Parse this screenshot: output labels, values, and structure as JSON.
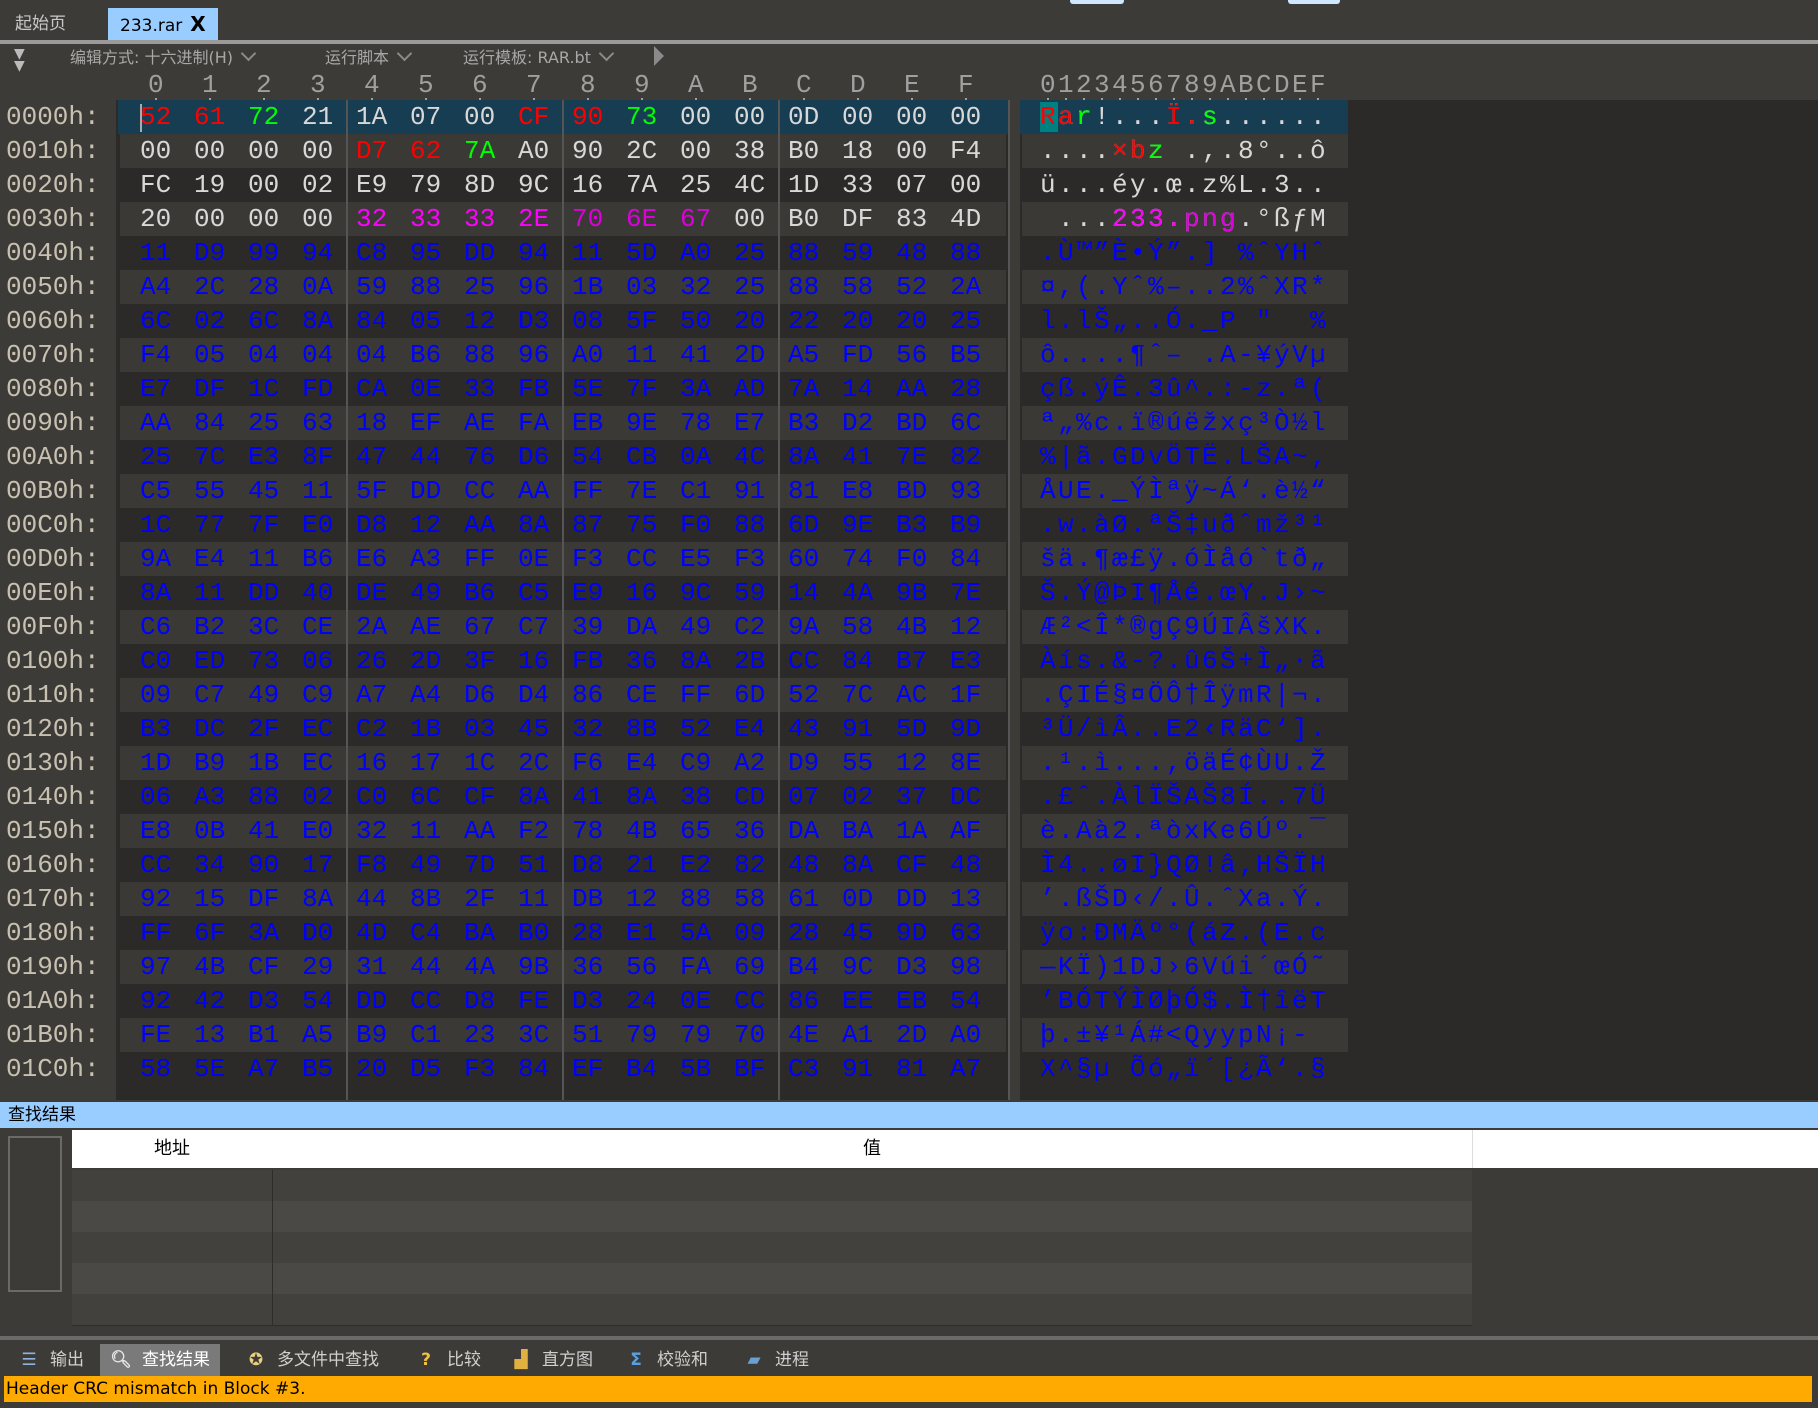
{
  "tabs": [
    {
      "label": "起始页",
      "active": false
    },
    {
      "label": "233.rar",
      "active": true
    }
  ],
  "tab_close": "X",
  "toolbar": {
    "edit_mode": "编辑方式: 十六进制(H)",
    "run_script": "运行脚本",
    "run_template": "运行模板: RAR.bt"
  },
  "hex_columns": [
    "0",
    "1",
    "2",
    "3",
    "4",
    "5",
    "6",
    "7",
    "8",
    "9",
    "A",
    "B",
    "C",
    "D",
    "E",
    "F"
  ],
  "ascii_header": "0123456789ABCDEF",
  "colors": {
    "normal": "#d8d8d8",
    "blue": "#0000ff",
    "red": "#ff0000",
    "green": "#00ff00",
    "magenta": "#ff00ff",
    "purple": "#dd00dd",
    "selected_row": "#173d52",
    "cursor_char": "#008080",
    "find_header": "#99ccff",
    "status_bg": "#ffaa00"
  },
  "rows": [
    {
      "addr": "0000h:",
      "hex": [
        "52",
        "61",
        "72",
        "21",
        "1A",
        "07",
        "00",
        "CF",
        "90",
        "73",
        "00",
        "00",
        "0D",
        "00",
        "00",
        "00"
      ],
      "ascii": "Rar!...Ï.s......",
      "color": "normal",
      "marks": {
        "0": "red",
        "1": "red",
        "2": "green",
        "7": "red",
        "8": "red",
        "9": "green"
      },
      "selected": true
    },
    {
      "addr": "0010h:",
      "hex": [
        "00",
        "00",
        "00",
        "00",
        "D7",
        "62",
        "7A",
        "A0",
        "90",
        "2C",
        "00",
        "38",
        "B0",
        "18",
        "00",
        "F4"
      ],
      "ascii": "....×bz .,.8°..ô",
      "color": "normal",
      "marks": {
        "4": "red",
        "5": "red",
        "6": "green"
      }
    },
    {
      "addr": "0020h:",
      "hex": [
        "FC",
        "19",
        "00",
        "02",
        "E9",
        "79",
        "8D",
        "9C",
        "16",
        "7A",
        "25",
        "4C",
        "1D",
        "33",
        "07",
        "00"
      ],
      "ascii": "ü...éy.œ.z%L.3..",
      "color": "normal",
      "marks": {}
    },
    {
      "addr": "0030h:",
      "hex": [
        "20",
        "00",
        "00",
        "00",
        "32",
        "33",
        "33",
        "2E",
        "70",
        "6E",
        "67",
        "00",
        "B0",
        "DF",
        "83",
        "4D"
      ],
      "ascii": " ...233.png.°ßƒM",
      "color": "normal",
      "marks": {
        "4": "magenta",
        "5": "magenta",
        "6": "magenta",
        "7": "magenta",
        "8": "purple",
        "9": "purple",
        "10": "purple"
      }
    },
    {
      "addr": "0040h:",
      "hex": [
        "11",
        "D9",
        "99",
        "94",
        "C8",
        "95",
        "DD",
        "94",
        "11",
        "5D",
        "A0",
        "25",
        "88",
        "59",
        "48",
        "88"
      ],
      "ascii": ".Ù™”È•Ý”.] %ˆYHˆ",
      "color": "blue",
      "marks": {}
    },
    {
      "addr": "0050h:",
      "hex": [
        "A4",
        "2C",
        "28",
        "0A",
        "59",
        "88",
        "25",
        "96",
        "1B",
        "03",
        "32",
        "25",
        "88",
        "58",
        "52",
        "2A"
      ],
      "ascii": "¤,(.Yˆ%–..2%ˆXR*",
      "color": "blue",
      "marks": {}
    },
    {
      "addr": "0060h:",
      "hex": [
        "6C",
        "02",
        "6C",
        "8A",
        "84",
        "05",
        "12",
        "D3",
        "08",
        "5F",
        "50",
        "20",
        "22",
        "20",
        "20",
        "25"
      ],
      "ascii": "l.lŠ„..Ó._P \"  %",
      "color": "blue",
      "marks": {}
    },
    {
      "addr": "0070h:",
      "hex": [
        "F4",
        "05",
        "04",
        "04",
        "04",
        "B6",
        "88",
        "96",
        "A0",
        "11",
        "41",
        "2D",
        "A5",
        "FD",
        "56",
        "B5"
      ],
      "ascii": "ô....¶ˆ– .A-¥ýVµ",
      "color": "blue",
      "marks": {}
    },
    {
      "addr": "0080h:",
      "hex": [
        "E7",
        "DF",
        "1C",
        "FD",
        "CA",
        "0E",
        "33",
        "FB",
        "5E",
        "7F",
        "3A",
        "AD",
        "7A",
        "14",
        "AA",
        "28"
      ],
      "ascii": "çß.ýÊ.3û^.:-z.ª(",
      "color": "blue",
      "marks": {}
    },
    {
      "addr": "0090h:",
      "hex": [
        "AA",
        "84",
        "25",
        "63",
        "18",
        "EF",
        "AE",
        "FA",
        "EB",
        "9E",
        "78",
        "E7",
        "B3",
        "D2",
        "BD",
        "6C"
      ],
      "ascii": "ª„%c.ï®úëžxç³Ò½l",
      "color": "blue",
      "marks": {}
    },
    {
      "addr": "00A0h:",
      "hex": [
        "25",
        "7C",
        "E3",
        "8F",
        "47",
        "44",
        "76",
        "D6",
        "54",
        "CB",
        "0A",
        "4C",
        "8A",
        "41",
        "7E",
        "82"
      ],
      "ascii": "%|ã.GDvÖTË.LŠA~‚",
      "color": "blue",
      "marks": {}
    },
    {
      "addr": "00B0h:",
      "hex": [
        "C5",
        "55",
        "45",
        "11",
        "5F",
        "DD",
        "CC",
        "AA",
        "FF",
        "7E",
        "C1",
        "91",
        "81",
        "E8",
        "BD",
        "93"
      ],
      "ascii": "ÅUE._ÝÌªÿ~Á‘.è½“",
      "color": "blue",
      "marks": {}
    },
    {
      "addr": "00C0h:",
      "hex": [
        "1C",
        "77",
        "7F",
        "E0",
        "D8",
        "12",
        "AA",
        "8A",
        "87",
        "75",
        "F0",
        "88",
        "6D",
        "9E",
        "B3",
        "B9"
      ],
      "ascii": ".w.àØ.ªŠ‡uðˆmž³¹",
      "color": "blue",
      "marks": {}
    },
    {
      "addr": "00D0h:",
      "hex": [
        "9A",
        "E4",
        "11",
        "B6",
        "E6",
        "A3",
        "FF",
        "0E",
        "F3",
        "CC",
        "E5",
        "F3",
        "60",
        "74",
        "F0",
        "84"
      ],
      "ascii": "šä.¶æ£ÿ.óÌåó`tð„",
      "color": "blue",
      "marks": {}
    },
    {
      "addr": "00E0h:",
      "hex": [
        "8A",
        "11",
        "DD",
        "40",
        "DE",
        "49",
        "B6",
        "C5",
        "E9",
        "16",
        "9C",
        "59",
        "14",
        "4A",
        "9B",
        "7E"
      ],
      "ascii": "Š.Ý@ÞI¶Åé.œY.J›~",
      "color": "blue",
      "marks": {}
    },
    {
      "addr": "00F0h:",
      "hex": [
        "C6",
        "B2",
        "3C",
        "CE",
        "2A",
        "AE",
        "67",
        "C7",
        "39",
        "DA",
        "49",
        "C2",
        "9A",
        "58",
        "4B",
        "12"
      ],
      "ascii": "Æ²<Î*®gÇ9ÚIÂšXK.",
      "color": "blue",
      "marks": {}
    },
    {
      "addr": "0100h:",
      "hex": [
        "C0",
        "ED",
        "73",
        "06",
        "26",
        "2D",
        "3F",
        "16",
        "FB",
        "36",
        "8A",
        "2B",
        "CC",
        "84",
        "B7",
        "E3"
      ],
      "ascii": "Àís.&-?.û6Š+Ì„·ã",
      "color": "blue",
      "marks": {}
    },
    {
      "addr": "0110h:",
      "hex": [
        "09",
        "C7",
        "49",
        "C9",
        "A7",
        "A4",
        "D6",
        "D4",
        "86",
        "CE",
        "FF",
        "6D",
        "52",
        "7C",
        "AC",
        "1F"
      ],
      "ascii": ".ÇIÉ§¤ÖÔ†ÎÿmR|¬.",
      "color": "blue",
      "marks": {}
    },
    {
      "addr": "0120h:",
      "hex": [
        "B3",
        "DC",
        "2F",
        "EC",
        "C2",
        "1B",
        "03",
        "45",
        "32",
        "8B",
        "52",
        "E4",
        "43",
        "91",
        "5D",
        "9D"
      ],
      "ascii": "³Ü/ìÂ..E2‹RäC‘].",
      "color": "blue",
      "marks": {}
    },
    {
      "addr": "0130h:",
      "hex": [
        "1D",
        "B9",
        "1B",
        "EC",
        "16",
        "17",
        "1C",
        "2C",
        "F6",
        "E4",
        "C9",
        "A2",
        "D9",
        "55",
        "12",
        "8E"
      ],
      "ascii": ".¹.ì...,öäÉ¢ÙU.Ž",
      "color": "blue",
      "marks": {}
    },
    {
      "addr": "0140h:",
      "hex": [
        "06",
        "A3",
        "88",
        "02",
        "C0",
        "6C",
        "CF",
        "8A",
        "41",
        "8A",
        "38",
        "CD",
        "07",
        "02",
        "37",
        "DC"
      ],
      "ascii": ".£ˆ.ÀlÏŠAŠ8Í..7Ü",
      "color": "blue",
      "marks": {}
    },
    {
      "addr": "0150h:",
      "hex": [
        "E8",
        "0B",
        "41",
        "E0",
        "32",
        "11",
        "AA",
        "F2",
        "78",
        "4B",
        "65",
        "36",
        "DA",
        "BA",
        "1A",
        "AF"
      ],
      "ascii": "è.Aà2.ªòxKe6Úº.¯",
      "color": "blue",
      "marks": {}
    },
    {
      "addr": "0160h:",
      "hex": [
        "CC",
        "34",
        "90",
        "17",
        "F8",
        "49",
        "7D",
        "51",
        "D8",
        "21",
        "E2",
        "82",
        "48",
        "8A",
        "CF",
        "48"
      ],
      "ascii": "Ì4..øI}QØ!â‚HŠÏH",
      "color": "blue",
      "marks": {}
    },
    {
      "addr": "0170h:",
      "hex": [
        "92",
        "15",
        "DF",
        "8A",
        "44",
        "8B",
        "2F",
        "11",
        "DB",
        "12",
        "88",
        "58",
        "61",
        "0D",
        "DD",
        "13"
      ],
      "ascii": "’.ßŠD‹/.Û.ˆXa.Ý.",
      "color": "blue",
      "marks": {}
    },
    {
      "addr": "0180h:",
      "hex": [
        "FF",
        "6F",
        "3A",
        "D0",
        "4D",
        "C4",
        "BA",
        "B0",
        "28",
        "E1",
        "5A",
        "09",
        "28",
        "45",
        "9D",
        "63"
      ],
      "ascii": "ÿo:ÐMÄº°(áZ.(E.c",
      "color": "blue",
      "marks": {}
    },
    {
      "addr": "0190h:",
      "hex": [
        "97",
        "4B",
        "CF",
        "29",
        "31",
        "44",
        "4A",
        "9B",
        "36",
        "56",
        "FA",
        "69",
        "B4",
        "9C",
        "D3",
        "98"
      ],
      "ascii": "—KÏ)1DJ›6Vúi´œÓ˜",
      "color": "blue",
      "marks": {}
    },
    {
      "addr": "01A0h:",
      "hex": [
        "92",
        "42",
        "D3",
        "54",
        "DD",
        "CC",
        "D8",
        "FE",
        "D3",
        "24",
        "0E",
        "CC",
        "86",
        "EE",
        "EB",
        "54"
      ],
      "ascii": "’BÓTÝÌØþÓ$.Ì†îëT",
      "color": "blue",
      "marks": {}
    },
    {
      "addr": "01B0h:",
      "hex": [
        "FE",
        "13",
        "B1",
        "A5",
        "B9",
        "C1",
        "23",
        "3C",
        "51",
        "79",
        "79",
        "70",
        "4E",
        "A1",
        "2D",
        "A0"
      ],
      "ascii": "þ.±¥¹Á#<QyypN¡- ",
      "color": "blue",
      "marks": {}
    },
    {
      "addr": "01C0h:",
      "hex": [
        "58",
        "5E",
        "A7",
        "B5",
        "20",
        "D5",
        "F3",
        "84",
        "EF",
        "B4",
        "5B",
        "BF",
        "C3",
        "91",
        "81",
        "A7"
      ],
      "ascii": "X^§µ Õó„ï´[¿Ã‘.§",
      "color": "blue",
      "marks": {}
    }
  ],
  "find_results": {
    "title": "查找结果",
    "columns": [
      "地址",
      "值"
    ]
  },
  "bottom_tabs": [
    {
      "label": "输出",
      "icon": "output-icon",
      "active": false
    },
    {
      "label": "查找结果",
      "icon": "magnifier-icon",
      "active": true
    },
    {
      "label": "多文件中查找",
      "icon": "multi-file-find-icon",
      "active": false
    },
    {
      "label": "比较",
      "icon": "question-compare-icon",
      "active": false
    },
    {
      "label": "直方图",
      "icon": "histogram-icon",
      "active": false
    },
    {
      "label": "校验和",
      "icon": "sigma-checksum-icon",
      "active": false
    },
    {
      "label": "进程",
      "icon": "process-chip-icon",
      "active": false
    }
  ],
  "status": "Header CRC mismatch in Block #3."
}
